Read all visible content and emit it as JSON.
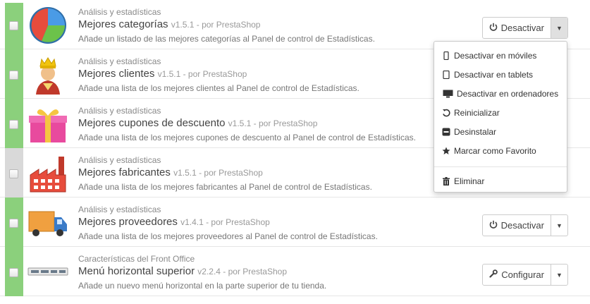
{
  "modules": [
    {
      "category": "Análisis y estadísticas",
      "name": "Mejores categorías",
      "meta": "v1.5.1 - por PrestaShop",
      "description": "Añade un listado de las mejores categorías al Panel de control de Estadísticas.",
      "enabled": true,
      "icon": "pie-chart-icon",
      "button": {
        "label": "Desactivar",
        "icon": "power-icon"
      }
    },
    {
      "category": "Análisis y estadísticas",
      "name": "Mejores clientes",
      "meta": "v1.5.1 - por PrestaShop",
      "description": "Añade una lista de los mejores clientes al Panel de control de Estadísticas.",
      "enabled": true,
      "icon": "king-icon"
    },
    {
      "category": "Análisis y estadísticas",
      "name": "Mejores cupones de descuento",
      "meta": "v1.5.1 - por PrestaShop",
      "description": "Añade una lista de los mejores cupones de descuento al Panel de control de Estadísticas.",
      "enabled": true,
      "icon": "gift-icon"
    },
    {
      "category": "Análisis y estadísticas",
      "name": "Mejores fabricantes",
      "meta": "v1.5.1 - por PrestaShop",
      "description": "Añade una lista de los mejores fabricantes al Panel de control de Estadísticas.",
      "enabled": false,
      "icon": "factory-icon"
    },
    {
      "category": "Análisis y estadísticas",
      "name": "Mejores proveedores",
      "meta": "v1.4.1 - por PrestaShop",
      "description": "Añade una lista de los mejores proveedores al Panel de control de Estadísticas.",
      "enabled": true,
      "icon": "truck-icon",
      "button": {
        "label": "Desactivar",
        "icon": "power-icon"
      }
    },
    {
      "category": "Características del Front Office",
      "name": "Menú horizontal superior",
      "meta": "v2.2.4 - por PrestaShop",
      "description": "Añade un nuevo menú horizontal en la parte superior de tu tienda.",
      "enabled": true,
      "icon": "menu-bar-icon",
      "button": {
        "label": "Configurar",
        "icon": "wrench-icon"
      }
    }
  ],
  "dropdown": {
    "items": [
      {
        "label": "Desactivar en móviles",
        "icon": "mobile-icon"
      },
      {
        "label": "Desactivar en tablets",
        "icon": "tablet-icon"
      },
      {
        "label": "Desactivar en ordenadores",
        "icon": "desktop-icon"
      },
      {
        "label": "Reinicializar",
        "icon": "undo-icon"
      },
      {
        "label": "Desinstalar",
        "icon": "minus-square-icon"
      },
      {
        "label": "Marcar como Favorito",
        "icon": "star-icon"
      }
    ],
    "danger_item": {
      "label": "Eliminar",
      "icon": "trash-icon"
    }
  },
  "colors": {
    "enabled": "#8bd07c",
    "disabled": "#d9d9d9"
  }
}
